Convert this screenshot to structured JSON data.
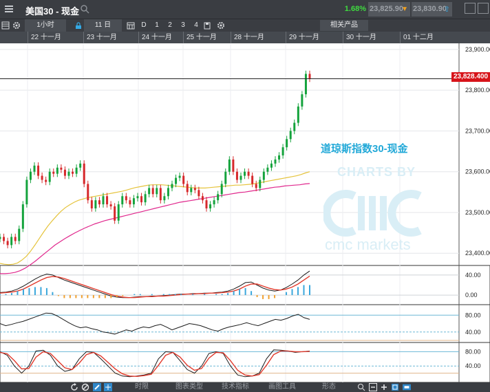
{
  "window": {
    "title": "美国30 - 现金",
    "change_percent": "1.68%",
    "sell_price": "23,825.90",
    "buy_price": "23,830.90",
    "colors": {
      "up": "#3fdc3f",
      "down_arrow": "#f0a020",
      "up_arrow": "#34a9e4",
      "brand": "#23a9d8",
      "price_tag": "#d7141a"
    }
  },
  "toolbar": {
    "interval": "1小时",
    "bars": "11 日",
    "range_buttons": [
      "D",
      "1",
      "2",
      "3",
      "4"
    ],
    "related_label": "相关产品",
    "icons": [
      "grid-icon",
      "gear-icon",
      "lock-icon",
      "calendar-icon",
      "save-icon",
      "gear-icon"
    ]
  },
  "dates": [
    "22 十一月",
    "23 十一月",
    "24 十一月",
    "25 十一月",
    "28 十一月",
    "29 十一月",
    "30 十一月",
    "01 十二月"
  ],
  "overlay": {
    "instrument_label": "道琼斯指数30-现金",
    "watermark_top": "CHARTS BY",
    "watermark_bottom": "cmc markets"
  },
  "current_price_tag": "23,828.400",
  "bottom_bar": {
    "tabs": [
      "时限",
      "图表类型",
      "技术指标",
      "画图工具",
      "形态"
    ]
  },
  "chart_data": [
    {
      "type": "candlestick",
      "title": "",
      "y_ticks": [
        "23,900.00",
        "23,800.00",
        "23,700.00",
        "23,600.00",
        "23,500.00",
        "23,400.00"
      ],
      "ylim": [
        23370,
        23915
      ],
      "x_categories": [
        "22 十一月",
        "23 十一月",
        "24 十一月",
        "25 十一月",
        "28 十一月",
        "29 十一月",
        "30 十一月",
        "01 十二月"
      ],
      "close_series": [
        23440,
        23430,
        23420,
        23440,
        23430,
        23460,
        23520,
        23580,
        23600,
        23615,
        23590,
        23580,
        23575,
        23600,
        23595,
        23610,
        23605,
        23590,
        23600,
        23595,
        23610,
        23620,
        23570,
        23530,
        23510,
        23530,
        23520,
        23540,
        23520,
        23515,
        23480,
        23520,
        23540,
        23530,
        23520,
        23535,
        23540,
        23525,
        23545,
        23560,
        23545,
        23560,
        23530,
        23540,
        23560,
        23570,
        23585,
        23590,
        23570,
        23550,
        23560,
        23555,
        23540,
        23530,
        23510,
        23520,
        23530,
        23545,
        23570,
        23600,
        23630,
        23600,
        23580,
        23590,
        23600,
        23590,
        23570,
        23560,
        23580,
        23600,
        23610,
        23620,
        23630,
        23640,
        23660,
        23680,
        23700,
        23720,
        23760,
        23790,
        23840,
        23828
      ],
      "moving_averages": [
        {
          "color": "#e5c33a",
          "values": [
            23375,
            23373,
            23372,
            23373,
            23376,
            23383,
            23392,
            23405,
            23420,
            23436,
            23452,
            23467,
            23480,
            23492,
            23503,
            23512,
            23519,
            23525,
            23530,
            23533,
            23536,
            23538,
            23540,
            23542,
            23544,
            23546,
            23548,
            23550,
            23552,
            23555,
            23558,
            23561,
            23563,
            23565,
            23567,
            23568,
            23568,
            23568,
            23567,
            23566,
            23565,
            23564,
            23563,
            23562,
            23561,
            23560,
            23560,
            23560,
            23561,
            23562,
            23563,
            23564,
            23565,
            23566,
            23567,
            23567,
            23568,
            23569,
            23570,
            23572,
            23574,
            23576,
            23578,
            23580,
            23582,
            23584,
            23586,
            23588,
            23590,
            23593,
            23597,
            23600
          ]
        },
        {
          "color": "#e0268c",
          "values": [
            23350,
            23350,
            23351,
            23353,
            23357,
            23363,
            23371,
            23380,
            23390,
            23400,
            23410,
            23420,
            23428,
            23436,
            23443,
            23450,
            23456,
            23462,
            23467,
            23472,
            23476,
            23480,
            23483,
            23486,
            23489,
            23492,
            23495,
            23498,
            23501,
            23504,
            23507,
            23510,
            23513,
            23516,
            23519,
            23522,
            23525,
            23527,
            23529,
            23531,
            23533,
            23535,
            23537,
            23539,
            23541,
            23543,
            23545,
            23547,
            23549,
            23550,
            23552,
            23554,
            23556,
            23558,
            23560,
            23562,
            23563,
            23565,
            23566,
            23567,
            23568,
            23570,
            23571
          ]
        }
      ]
    },
    {
      "type": "line",
      "title": "",
      "y_ticks": [
        "40.00",
        "0.00"
      ],
      "series": [
        {
          "color": "#1a1a1a",
          "values": [
            5,
            6,
            8,
            12,
            18,
            25,
            32,
            38,
            42,
            40,
            35,
            30,
            26,
            22,
            18,
            14,
            10,
            6,
            2,
            -2,
            -4,
            -5,
            -5,
            -4,
            -3,
            -3,
            -2,
            -2,
            -1,
            0,
            1,
            2,
            2,
            3,
            3,
            4,
            4,
            5,
            6,
            8,
            12,
            18,
            25,
            26,
            20,
            14,
            10,
            8,
            10,
            15,
            22,
            30,
            40,
            48
          ]
        },
        {
          "color": "#e23a2c",
          "values": [
            4,
            5,
            6,
            8,
            12,
            18,
            24,
            30,
            35,
            37,
            36,
            33,
            29,
            25,
            21,
            17,
            13,
            9,
            5,
            1,
            -2,
            -4,
            -5,
            -5,
            -4,
            -3,
            -3,
            -2,
            -2,
            -1,
            0,
            1,
            2,
            2,
            3,
            3,
            4,
            4,
            5,
            6,
            8,
            12,
            18,
            22,
            22,
            18,
            14,
            11,
            10,
            12,
            16,
            22,
            30,
            38
          ]
        }
      ]
    },
    {
      "type": "line",
      "title": "",
      "y_ticks": [
        "80.00",
        "40.00"
      ],
      "series": [
        {
          "color": "#1a1a1a",
          "values": [
            60,
            55,
            58,
            62,
            65,
            70,
            75,
            80,
            85,
            84,
            78,
            70,
            62,
            55,
            50,
            52,
            48,
            45,
            40,
            38,
            35,
            40,
            45,
            42,
            48,
            52,
            50,
            55,
            58,
            52,
            45,
            50,
            55,
            60,
            58,
            55,
            50,
            45,
            42,
            48,
            52,
            55,
            58,
            62,
            58,
            55,
            60,
            65,
            70,
            68,
            72,
            78,
            82,
            74,
            70
          ]
        }
      ]
    },
    {
      "type": "line",
      "title": "",
      "y_ticks": [
        "80.00",
        "40.00"
      ],
      "series": [
        {
          "color": "#1a1a1a",
          "values": [
            80,
            70,
            40,
            20,
            40,
            82,
            84,
            70,
            40,
            25,
            30,
            60,
            80,
            78,
            60,
            40,
            20,
            12,
            10,
            12,
            15,
            20,
            60,
            80,
            78,
            55,
            30,
            20,
            40,
            75,
            80,
            75,
            40,
            15,
            10,
            12,
            20,
            60,
            85,
            84,
            82,
            78,
            80,
            82
          ]
        },
        {
          "color": "#e23a2c",
          "values": [
            78,
            74,
            55,
            32,
            33,
            65,
            80,
            75,
            55,
            35,
            30,
            48,
            72,
            78,
            68,
            50,
            32,
            18,
            12,
            11,
            13,
            17,
            42,
            70,
            78,
            65,
            42,
            28,
            33,
            62,
            78,
            77,
            55,
            28,
            15,
            12,
            16,
            42,
            72,
            82,
            82,
            80,
            80,
            81
          ]
        }
      ]
    }
  ]
}
